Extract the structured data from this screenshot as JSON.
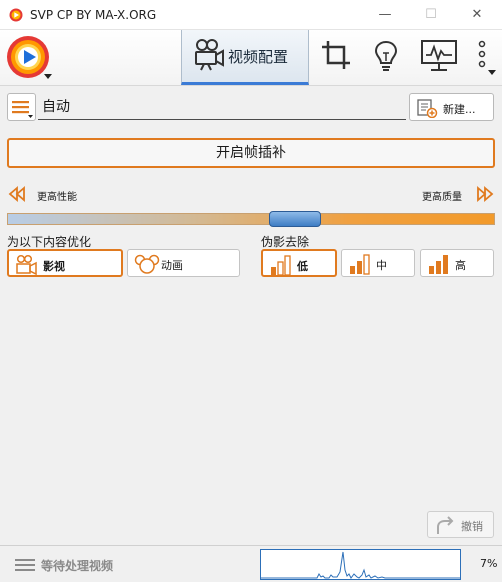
{
  "window": {
    "title": "SVP CP BY MA-X.ORG",
    "minimize_glyph": "—",
    "maximize_glyph": "☐",
    "close_glyph": "✕"
  },
  "toolbar": {
    "active_tab_label": "视频配置",
    "icons": [
      "svp-logo-icon",
      "video-camera-icon",
      "crop-icon",
      "lightbulb-icon",
      "monitor-icon",
      "more-options-icon"
    ]
  },
  "profile": {
    "name": "自动",
    "new_label": "新建..."
  },
  "interpolation": {
    "button_label": "开启帧插补"
  },
  "quality_slider": {
    "left_label": "更高性能",
    "right_label": "更高质量",
    "value": 0.59
  },
  "optimize": {
    "label": "为以下内容优化",
    "options": [
      {
        "label": "影视",
        "icon": "film-camera-icon",
        "selected": true
      },
      {
        "label": "动画",
        "icon": "mouse-head-icon",
        "selected": false
      }
    ]
  },
  "artifact": {
    "label": "伪影去除",
    "options": [
      {
        "label": "低",
        "selected": true
      },
      {
        "label": "中",
        "selected": false
      },
      {
        "label": "高",
        "selected": false
      }
    ]
  },
  "undo": {
    "label": "撤销"
  },
  "status": {
    "text": "等待处理视频",
    "cpu_percent": "7%"
  },
  "colors": {
    "accent_orange": "#e07a1f",
    "accent_blue": "#3b7bd6",
    "graph_blue": "#2c6fb8"
  }
}
